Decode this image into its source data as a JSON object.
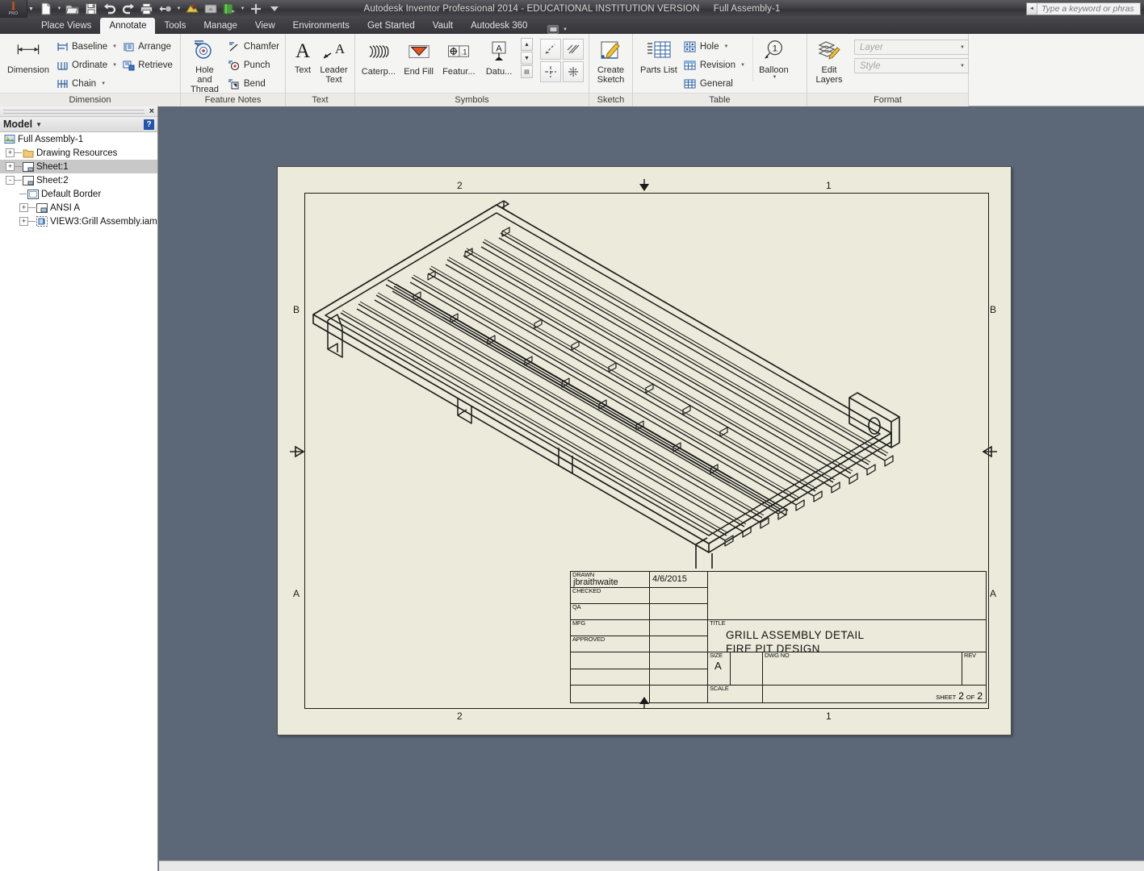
{
  "titlebar": {
    "app_title": "Autodesk Inventor Professional 2014 - EDUCATIONAL INSTITUTION VERSION",
    "document_title": "Full Assembly-1",
    "search_placeholder": "Type a keyword or phrase",
    "logo_text": "I",
    "logo_sub": "PRO",
    "quick_access": [
      {
        "name": "new-icon",
        "label": "New"
      },
      {
        "name": "open-icon",
        "label": "Open"
      },
      {
        "name": "save-icon",
        "label": "Save"
      },
      {
        "name": "undo-icon",
        "label": "Undo"
      },
      {
        "name": "redo-icon",
        "label": "Redo"
      },
      {
        "name": "print-icon",
        "label": "Print"
      },
      {
        "name": "return-icon",
        "label": "Return"
      },
      {
        "name": "update-icon",
        "label": "Update"
      },
      {
        "name": "select-icon",
        "label": "Select"
      },
      {
        "name": "material-icon",
        "label": "Material"
      },
      {
        "name": "plus-icon",
        "label": "Customize"
      },
      {
        "name": "overflow-icon",
        "label": "More"
      }
    ]
  },
  "tabs": [
    {
      "label": "Place Views",
      "active": false
    },
    {
      "label": "Annotate",
      "active": true
    },
    {
      "label": "Tools",
      "active": false
    },
    {
      "label": "Manage",
      "active": false
    },
    {
      "label": "View",
      "active": false
    },
    {
      "label": "Environments",
      "active": false
    },
    {
      "label": "Get Started",
      "active": false
    },
    {
      "label": "Vault",
      "active": false
    },
    {
      "label": "Autodesk 360",
      "active": false
    }
  ],
  "ribbon": {
    "panels": [
      {
        "title": "Dimension",
        "big": [
          {
            "label": "Dimension",
            "icon": "dimension-icon"
          }
        ],
        "small": [
          {
            "label": "Baseline",
            "icon": "baseline-icon",
            "dropdown": true
          },
          {
            "label": "Ordinate",
            "icon": "ordinate-icon",
            "dropdown": true
          },
          {
            "label": "Chain",
            "icon": "chain-icon",
            "dropdown": true
          },
          {
            "label": "Arrange",
            "icon": "arrange-icon",
            "dropdown": false
          },
          {
            "label": "Retrieve",
            "icon": "retrieve-icon",
            "dropdown": false
          }
        ]
      },
      {
        "title": "Feature Notes",
        "big": [
          {
            "label": "Hole and Thread",
            "icon": "hole-thread-icon"
          }
        ],
        "small": [
          {
            "label": "Chamfer",
            "icon": "chamfer-icon",
            "dropdown": false
          },
          {
            "label": "Punch",
            "icon": "punch-icon",
            "dropdown": false
          },
          {
            "label": "Bend",
            "icon": "bend-icon",
            "dropdown": false
          }
        ]
      },
      {
        "title": "Text",
        "big": [
          {
            "label": "Text",
            "icon": "text-icon"
          },
          {
            "label": "Leader Text",
            "icon": "leader-text-icon"
          }
        ],
        "small": []
      },
      {
        "title": "Symbols",
        "symbols": [
          {
            "label": "Caterp...",
            "icon": "caterpillar-icon"
          },
          {
            "label": "End Fill",
            "icon": "end-fill-icon"
          },
          {
            "label": "Featur...",
            "icon": "feature-control-frame-icon"
          },
          {
            "label": "Datu...",
            "icon": "datum-identifier-icon"
          }
        ],
        "extra_buttons": [
          {
            "icon": "surface-texture-icon"
          },
          {
            "icon": "weld-symbol-icon"
          },
          {
            "icon": "center-mark-icon"
          },
          {
            "icon": "centerline-pattern-icon"
          }
        ]
      },
      {
        "title": "Sketch",
        "big": [
          {
            "label": "Create Sketch",
            "icon": "create-sketch-icon"
          }
        ],
        "small": []
      },
      {
        "title": "Table",
        "big": [
          {
            "label": "Parts List",
            "icon": "parts-list-icon"
          },
          {
            "label": "Balloon",
            "icon": "balloon-icon",
            "dropdown": true
          }
        ],
        "small": [
          {
            "label": "Hole",
            "icon": "hole-table-icon",
            "dropdown": true
          },
          {
            "label": "Revision",
            "icon": "revision-table-icon",
            "dropdown": true
          },
          {
            "label": "General",
            "icon": "general-table-icon",
            "dropdown": false
          }
        ]
      },
      {
        "title": "Format",
        "big": [
          {
            "label": "Edit Layers",
            "icon": "edit-layers-icon"
          }
        ],
        "combos": [
          {
            "name": "layer-combo",
            "value": "Layer"
          },
          {
            "name": "style-combo",
            "value": "Style"
          }
        ]
      }
    ]
  },
  "browser": {
    "panel_title": "Model",
    "help_label": "?",
    "close_label": "×",
    "tree": [
      {
        "label": "Full Assembly-1",
        "depth": 0,
        "icon": "assembly-icon",
        "expander": "",
        "selected": false
      },
      {
        "label": "Drawing Resources",
        "depth": 1,
        "icon": "folder-icon",
        "expander": "+",
        "selected": false
      },
      {
        "label": "Sheet:1",
        "depth": 1,
        "icon": "sheet-icon",
        "expander": "+",
        "selected": true
      },
      {
        "label": "Sheet:2",
        "depth": 1,
        "icon": "sheet-icon",
        "expander": "-",
        "selected": false
      },
      {
        "label": "Default Border",
        "depth": 2,
        "icon": "border-icon",
        "expander": "",
        "selected": false
      },
      {
        "label": "ANSI A",
        "depth": 2,
        "icon": "titleblock-icon",
        "expander": "+",
        "selected": false
      },
      {
        "label": "VIEW3:Grill Assembly.iam",
        "depth": 2,
        "icon": "view-icon",
        "expander": "+",
        "selected": false
      }
    ]
  },
  "sheet": {
    "paper_color": "#eceada",
    "background_color": "#5c6878",
    "zone_labels_top": [
      "2",
      "1"
    ],
    "zone_labels_bottom": [
      "2",
      "1"
    ],
    "zone_labels_left": [
      "B",
      "A"
    ],
    "zone_labels_right": [
      "B",
      "A"
    ],
    "drawing_name": "grill-assembly-isometric-view"
  },
  "titleblock": {
    "rows": [
      {
        "caption": "DRAWN",
        "value": "jbraithwaite",
        "date": "4/6/2015"
      },
      {
        "caption": "CHECKED",
        "value": "",
        "date": ""
      },
      {
        "caption": "QA",
        "value": "",
        "date": ""
      },
      {
        "caption": "MFG",
        "value": "",
        "date": ""
      },
      {
        "caption": "APPROVED",
        "value": "",
        "date": ""
      },
      {
        "caption": "",
        "value": "",
        "date": ""
      },
      {
        "caption": "",
        "value": "",
        "date": ""
      },
      {
        "caption": "",
        "value": "",
        "date": ""
      }
    ],
    "title_caption": "TITLE",
    "title_line1": "GRILL ASSEMBLY DETAIL",
    "title_line2": "FIRE PIT DESIGN",
    "size_caption": "SIZE",
    "size_value": "A",
    "dwg_no_caption": "DWG NO",
    "dwg_no_value": "",
    "rev_caption": "REV",
    "rev_value": "",
    "scale_caption": "SCALE",
    "scale_value": "",
    "sheet_caption": "SHEET",
    "sheet_number": "2",
    "sheet_of": "OF",
    "sheet_total": "2"
  }
}
